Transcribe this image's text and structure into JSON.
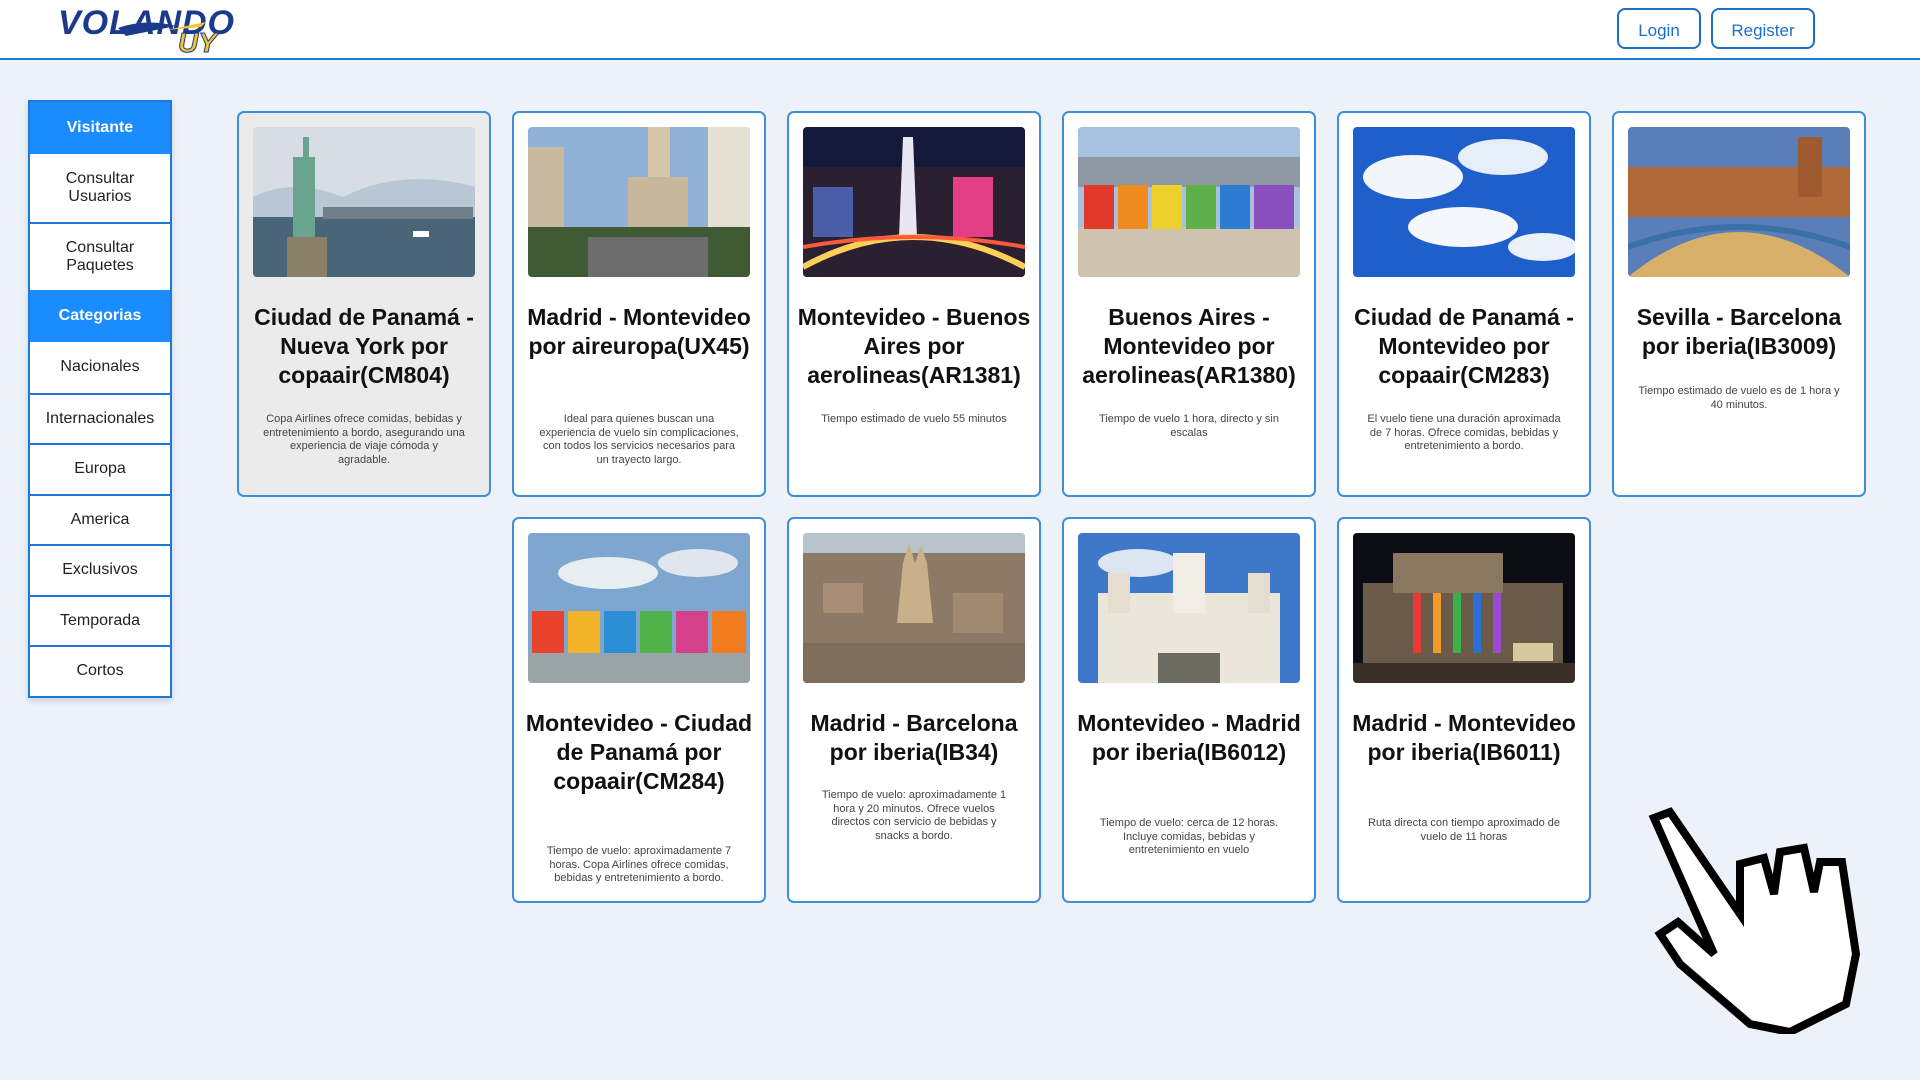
{
  "header": {
    "logo_text_1": "VOLANDO",
    "logo_text_2": "UY",
    "login_label": "Login",
    "register_label": "Register"
  },
  "sidebar": {
    "visitor_heading": "Visitante",
    "visitor_items": [
      "Consultar Usuarios",
      "Consultar Paquetes"
    ],
    "categories_heading": "Categorias",
    "category_items": [
      "Nacionales",
      "Internacionales",
      "Europa",
      "America",
      "Exclusivos",
      "Temporada",
      "Cortos"
    ]
  },
  "flights": [
    {
      "title": "Ciudad de Panamá - Nueva York por copaair(CM804)",
      "description": "Copa Airlines ofrece comidas, bebidas y entretenimiento a bordo, asegurando una experiencia de viaje cómoda y agradable.",
      "image": "statue-of-liberty"
    },
    {
      "title": "Madrid - Montevideo por aireuropa(UX45)",
      "description": "Ideal para quienes buscan una experiencia de vuelo sin complicaciones, con todos los servicios necesarios para un trayecto largo.",
      "image": "plaza-city-street"
    },
    {
      "title": "Montevideo - Buenos Aires por aerolineas(AR1381)",
      "description": "Tiempo estimado de vuelo 55 minutos",
      "image": "obelisco-night"
    },
    {
      "title": "Buenos Aires - Montevideo por aerolineas(AR1380)",
      "description": "Tiempo de vuelo 1 hora, directo y sin escalas",
      "image": "montevideo-letters"
    },
    {
      "title": "Ciudad de Panamá - Montevideo por copaair(CM283)",
      "description": "El vuelo tiene una duración aproximada de 7 horas. Ofrece comidas, bebidas y entretenimiento a bordo.",
      "image": "blue-sky-clouds"
    },
    {
      "title": "Sevilla - Barcelona por iberia(IB3009)",
      "description": "Tiempo estimado de vuelo es de 1 hora y 40 minutos.",
      "image": "plaza-de-espana"
    },
    {
      "title": "Montevideo - Ciudad de Panamá por copaair(CM284)",
      "description": "Tiempo de vuelo: aproximadamente 7 horas. Copa Airlines ofrece comidas, bebidas y entretenimiento a bordo.",
      "image": "panama-letters"
    },
    {
      "title": "Madrid - Barcelona por iberia(IB34)",
      "description": "Tiempo de vuelo: aproximadamente 1 hora y 20 minutos. Ofrece vuelos directos con servicio de bebidas y snacks a bordo.",
      "image": "barcelona-aerial"
    },
    {
      "title": "Montevideo - Madrid por iberia(IB6012)",
      "description": "Tiempo de vuelo: cerca de 12 horas. Incluye comidas, bebidas y entretenimiento en vuelo",
      "image": "palacio-cibeles"
    },
    {
      "title": "Madrid - Montevideo por iberia(IB6011)",
      "description": "Ruta directa con tiempo aproximado de vuelo de 11 horas",
      "image": "teatro-solis-night"
    }
  ],
  "colors": {
    "accent": "#1a8cff",
    "border": "#1e78d6",
    "background": "#edf2fa"
  }
}
